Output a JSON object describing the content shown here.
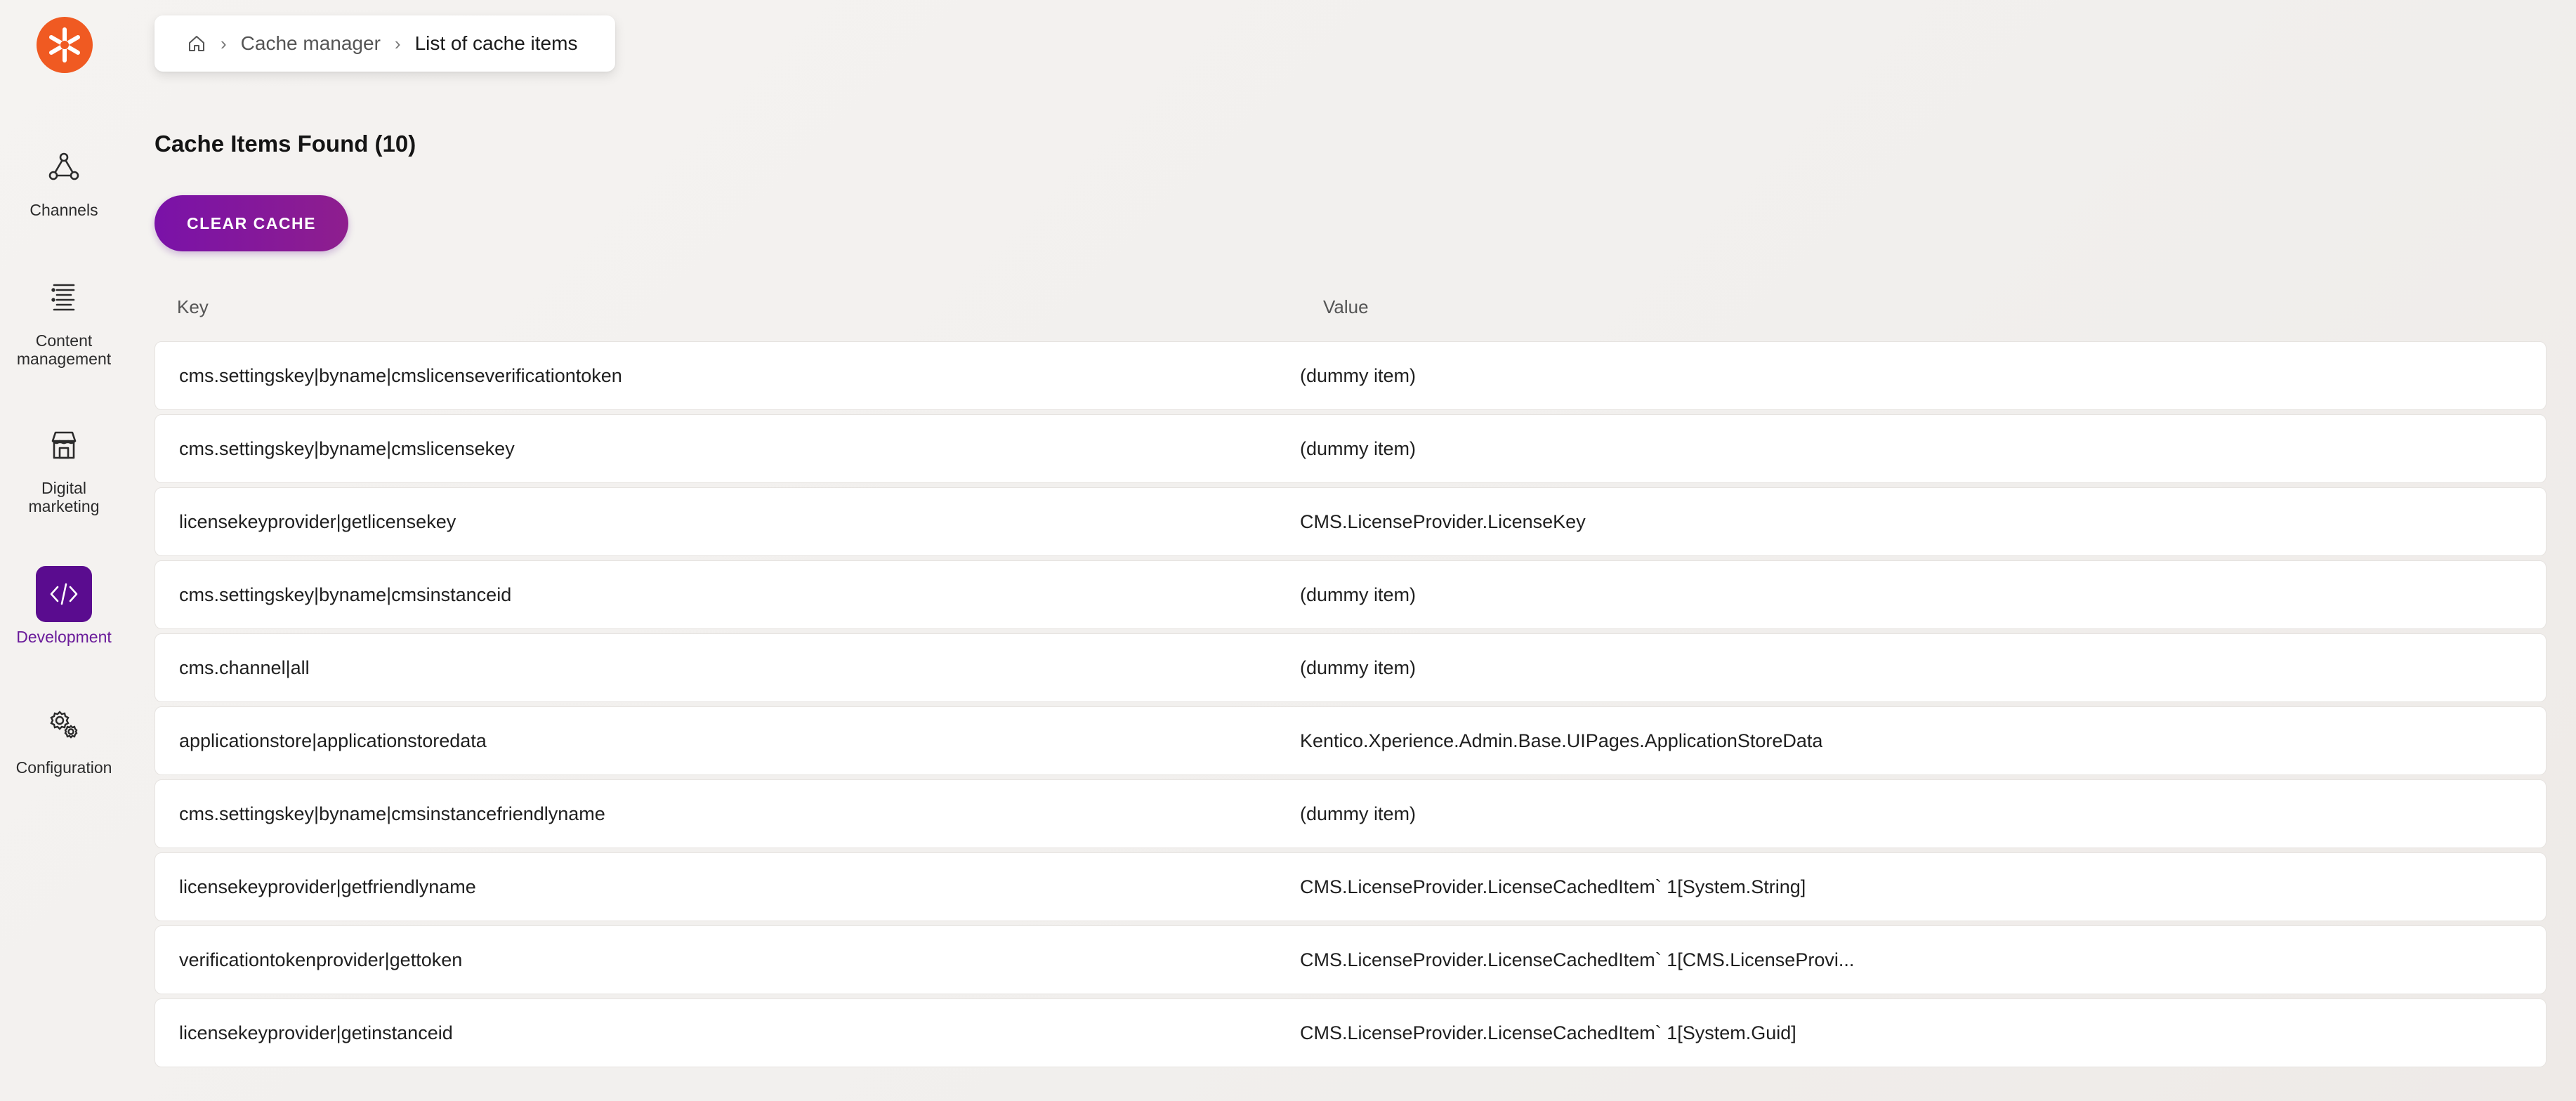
{
  "sidebar": {
    "items": [
      {
        "label": "Channels",
        "icon": "channels-icon"
      },
      {
        "label": "Content management",
        "icon": "content-management-icon"
      },
      {
        "label": "Digital marketing",
        "icon": "digital-marketing-icon"
      },
      {
        "label": "Development",
        "icon": "development-icon",
        "active": true
      },
      {
        "label": "Configuration",
        "icon": "configuration-icon"
      }
    ],
    "logo_icon": "kentico-logo-icon"
  },
  "breadcrumb": {
    "home_icon": "home-icon",
    "items": [
      "Cache manager",
      "List of cache items"
    ]
  },
  "page": {
    "title": "Cache Items Found (10)",
    "clear_button": "CLEAR CACHE"
  },
  "table": {
    "headers": {
      "key": "Key",
      "value": "Value"
    },
    "rows": [
      {
        "key": "cms.settingskey|byname|cmslicenseverificationtoken",
        "value": "(dummy item)"
      },
      {
        "key": "cms.settingskey|byname|cmslicensekey",
        "value": "(dummy item)"
      },
      {
        "key": "licensekeyprovider|getlicensekey",
        "value": "CMS.LicenseProvider.LicenseKey"
      },
      {
        "key": "cms.settingskey|byname|cmsinstanceid",
        "value": "(dummy item)"
      },
      {
        "key": "cms.channel|all",
        "value": "(dummy item)"
      },
      {
        "key": "applicationstore|applicationstoredata",
        "value": "Kentico.Xperience.Admin.Base.UIPages.ApplicationStoreData"
      },
      {
        "key": "cms.settingskey|byname|cmsinstancefriendlyname",
        "value": "(dummy item)"
      },
      {
        "key": "licensekeyprovider|getfriendlyname",
        "value": "CMS.LicenseProvider.LicenseCachedItem` 1[System.String]"
      },
      {
        "key": "verificationtokenprovider|gettoken",
        "value": "CMS.LicenseProvider.LicenseCachedItem` 1[CMS.LicenseProvi..."
      },
      {
        "key": "licensekeyprovider|getinstanceid",
        "value": "CMS.LicenseProvider.LicenseCachedItem` 1[System.Guid]"
      }
    ]
  },
  "colors": {
    "accent": "#5a0c8f",
    "logo": "#f05a22",
    "button_start": "#7a12a8",
    "button_end": "#8e1e8e"
  }
}
